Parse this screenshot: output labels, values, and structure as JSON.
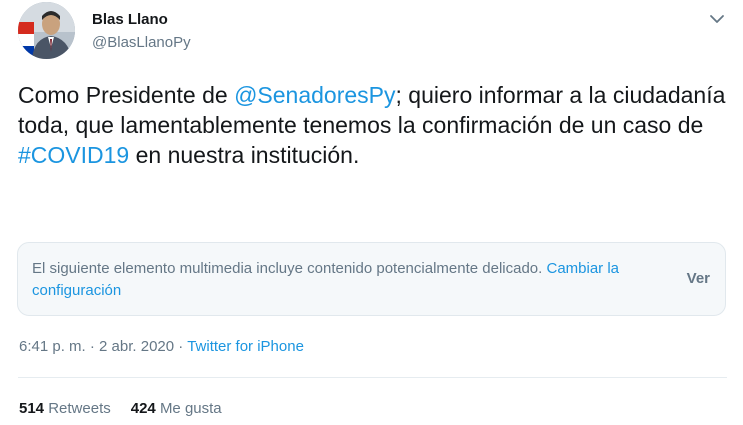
{
  "author": {
    "name": "Blas Llano",
    "handle": "@BlasLlanoPy"
  },
  "tweet": {
    "text_before_mention": "Como Presidente de ",
    "mention": "@SenadoresPy",
    "text_after_mention": "; quiero informar a la ciudadanía toda, que lamentablemente tenemos la confirmación de un caso de ",
    "hashtag": "#COVID19",
    "text_after_hashtag": " en nuestra institución."
  },
  "sensitive_notice": {
    "text": "El siguiente elemento multimedia incluye contenido potencialmente delicado.",
    "settings_link": "Cambiar la configuración",
    "view_label": "Ver"
  },
  "meta": {
    "time": "6:41 p. m.",
    "separator": "·",
    "date": "2 abr. 2020",
    "source": "Twitter for iPhone"
  },
  "stats": {
    "retweets_count": "514",
    "retweets_label": "Retweets",
    "likes_count": "424",
    "likes_label": "Me gusta"
  },
  "icons": {
    "menu": "chevron-down-icon"
  },
  "colors": {
    "link": "#1b95e0",
    "secondary_text": "#657786",
    "primary_text": "#14171a",
    "notice_bg": "#f5f8fa"
  }
}
